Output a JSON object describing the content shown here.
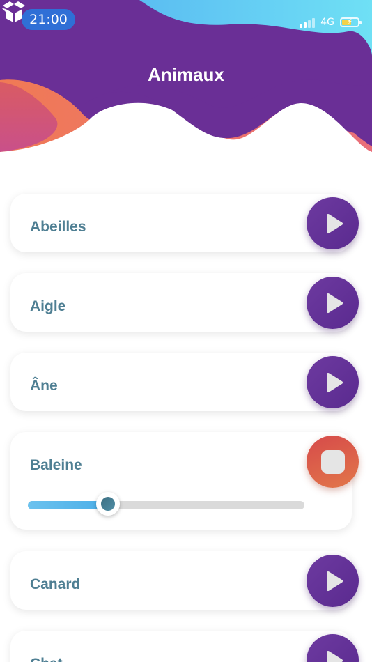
{
  "status_bar": {
    "time": "21:00",
    "network": "4G",
    "battery_level": 0.6
  },
  "header": {
    "title": "Animaux",
    "icon": "open-box-icon"
  },
  "colors": {
    "header_purple": "#6a2f96",
    "accent_orange": "#ee8a55",
    "accent_pink": "#d65a7a",
    "sky_blue": "#5ec8f2",
    "label_text": "#4f7f93",
    "play_button": "#5e2d8f",
    "stop_button": "#dc5a48",
    "slider_fill": "#5ab7ec"
  },
  "items": [
    {
      "label": "Abeilles",
      "state": "play"
    },
    {
      "label": "Aigle",
      "state": "play"
    },
    {
      "label": "Âne",
      "state": "play"
    },
    {
      "label": "Baleine",
      "state": "stop",
      "progress": 0.29
    },
    {
      "label": "Canard",
      "state": "play"
    },
    {
      "label": "Chat",
      "state": "play"
    }
  ]
}
